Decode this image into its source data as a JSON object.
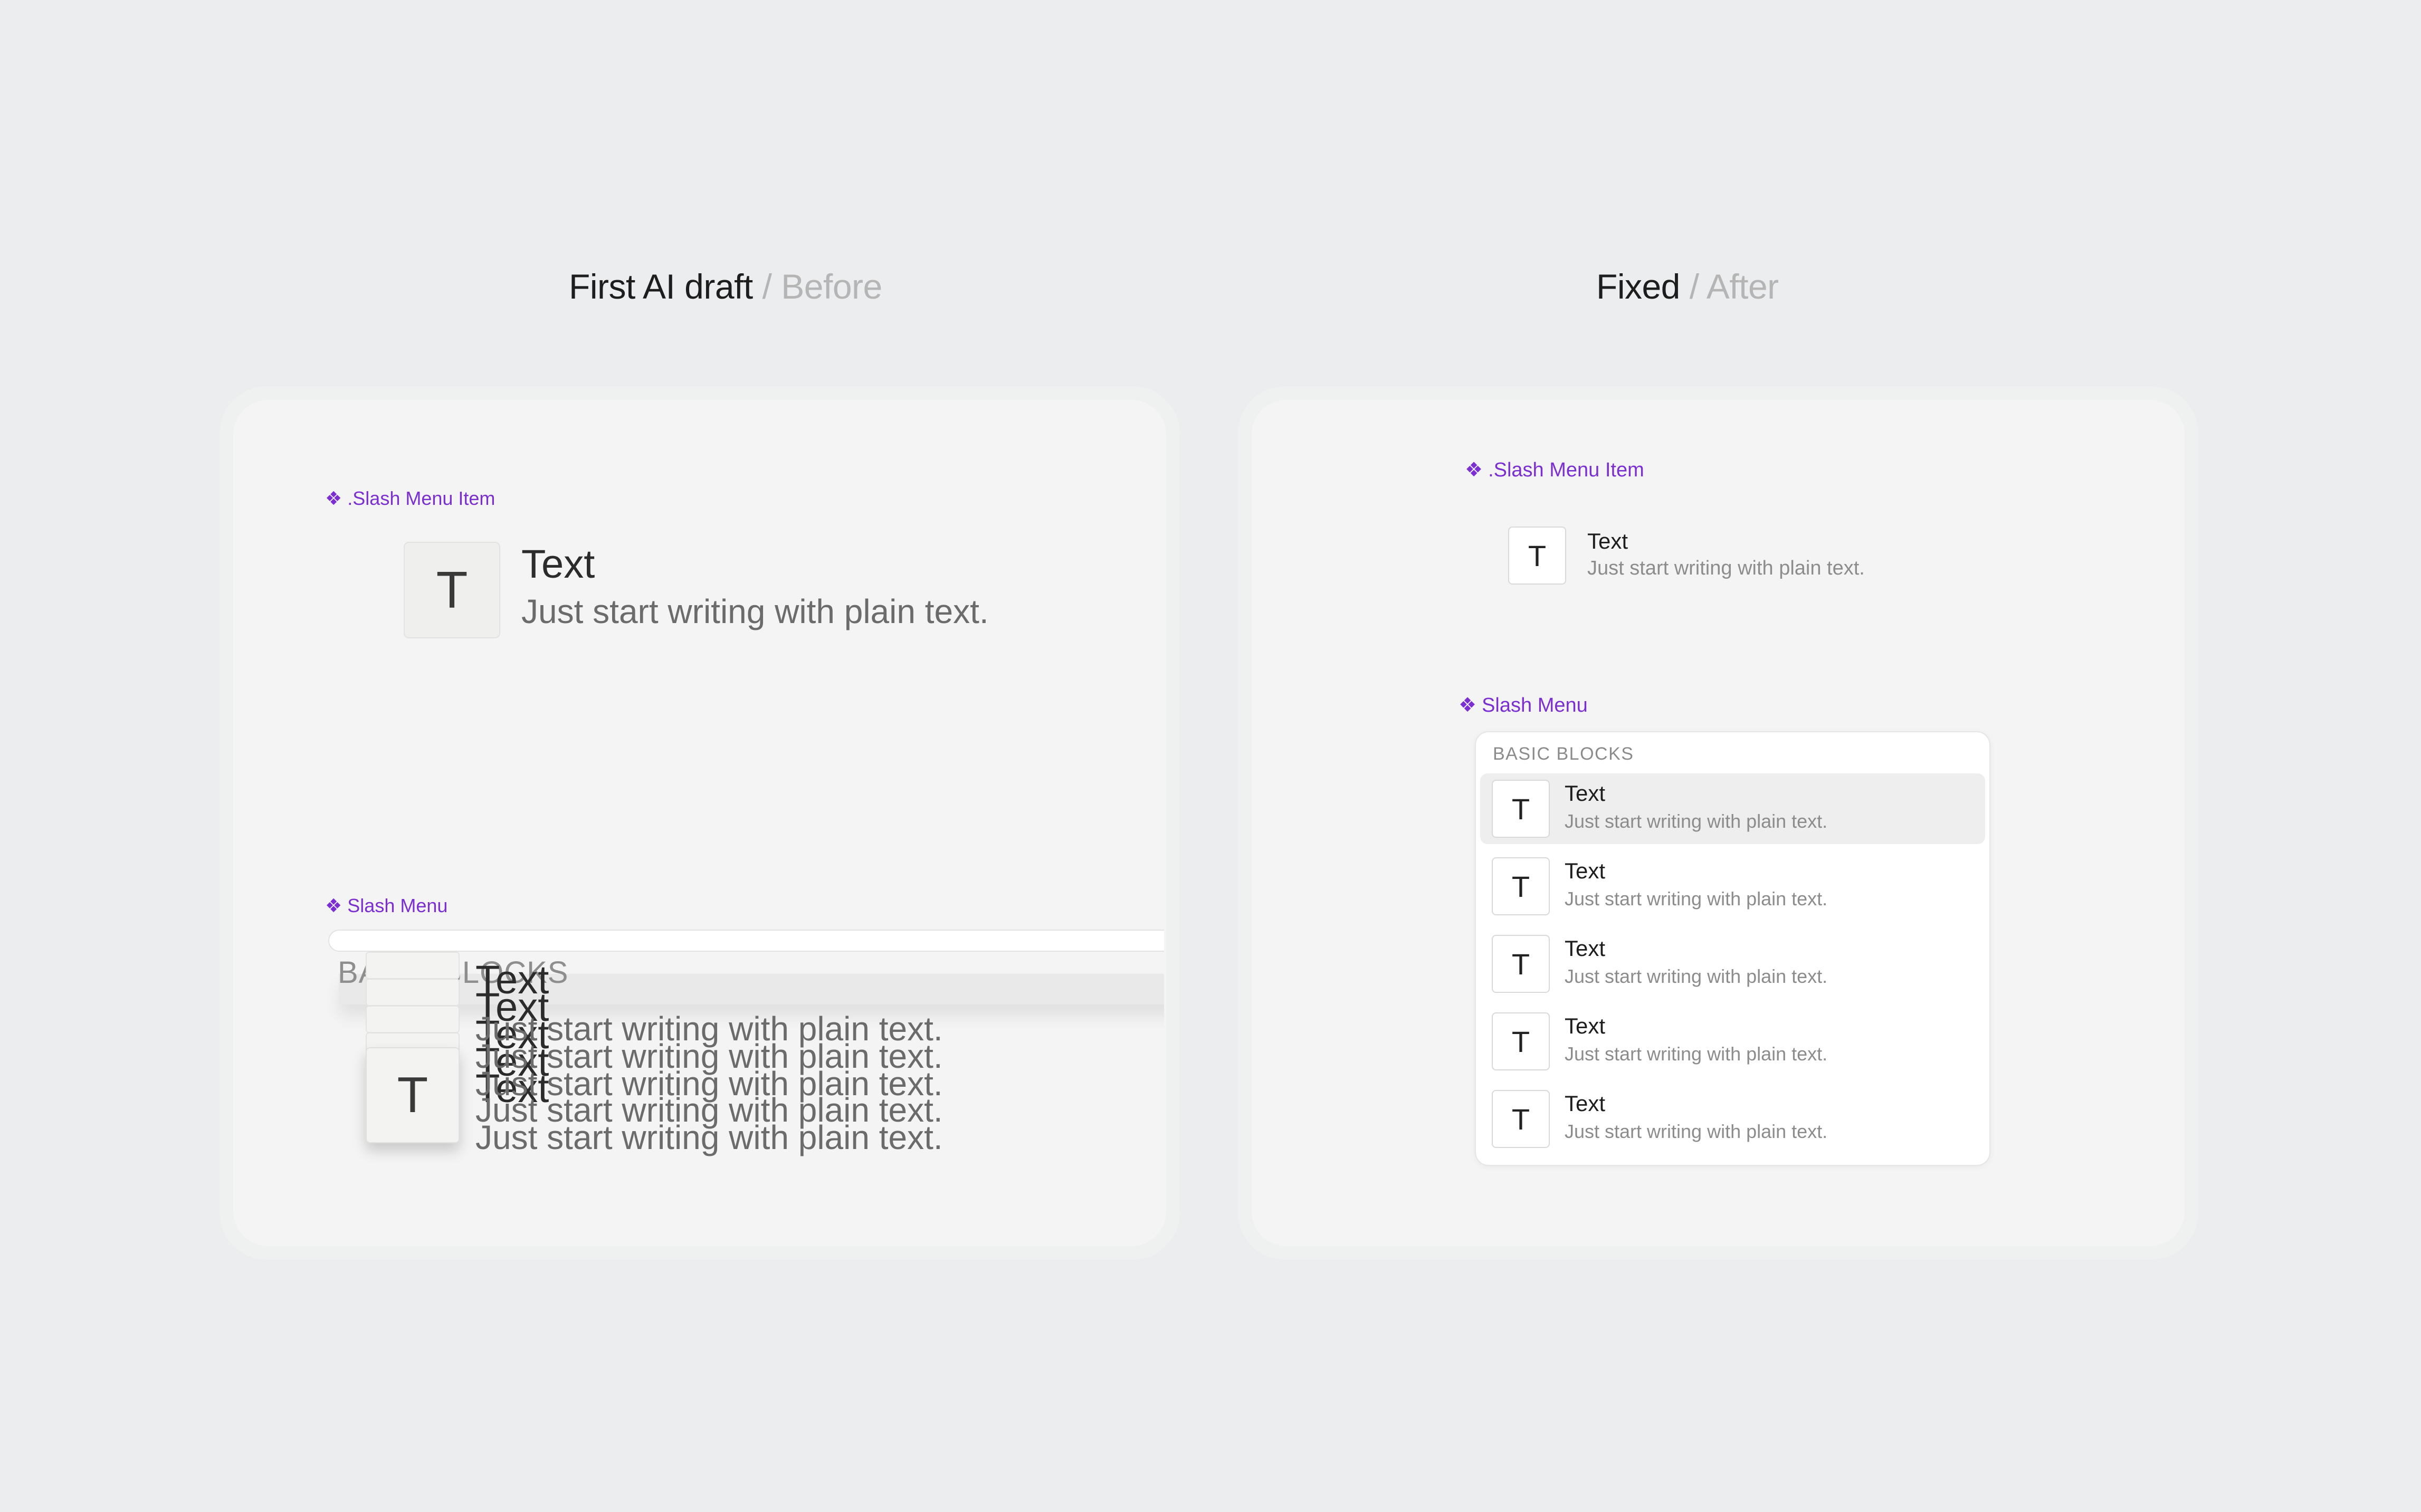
{
  "before": {
    "heading_main": "First AI draft",
    "heading_dim": " / Before",
    "component_tag": ".Slash Menu Item",
    "item": {
      "icon_letter": "T",
      "title": "Text",
      "subtitle": "Just start writing with plain text."
    },
    "menu_tag": "Slash Menu",
    "menu_section": "BASIC BLOCKS",
    "menu_items": [
      {
        "icon_letter": "T",
        "title": "Text",
        "subtitle": "Just start writing with plain text."
      },
      {
        "icon_letter": "T",
        "title": "Text",
        "subtitle": "Just start writing with plain text."
      },
      {
        "icon_letter": "T",
        "title": "Text",
        "subtitle": "Just start writing with plain text."
      },
      {
        "icon_letter": "T",
        "title": "Text",
        "subtitle": "Just start writing with plain text."
      },
      {
        "icon_letter": "T",
        "title": "Text",
        "subtitle": "Just start writing with plain text."
      }
    ]
  },
  "after": {
    "heading_main": "Fixed",
    "heading_dim": " / After",
    "component_tag": ".Slash Menu Item",
    "item": {
      "icon_letter": "T",
      "title": "Text",
      "subtitle": "Just start writing with plain text."
    },
    "menu_tag": "Slash Menu",
    "menu_section": "BASIC BLOCKS",
    "menu_items": [
      {
        "icon_letter": "T",
        "title": "Text",
        "subtitle": "Just start writing with plain text.",
        "active": true
      },
      {
        "icon_letter": "T",
        "title": "Text",
        "subtitle": "Just start writing with plain text."
      },
      {
        "icon_letter": "T",
        "title": "Text",
        "subtitle": "Just start writing with plain text."
      },
      {
        "icon_letter": "T",
        "title": "Text",
        "subtitle": "Just start writing with plain text."
      },
      {
        "icon_letter": "T",
        "title": "Text",
        "subtitle": "Just start writing with plain text."
      }
    ]
  },
  "icons": {
    "component": "figma-component-icon"
  },
  "colors": {
    "background": "#ecedee",
    "accent": "#7b2fd1",
    "dim_text": "#b5b5b5",
    "active_row": "#eeeeee"
  }
}
